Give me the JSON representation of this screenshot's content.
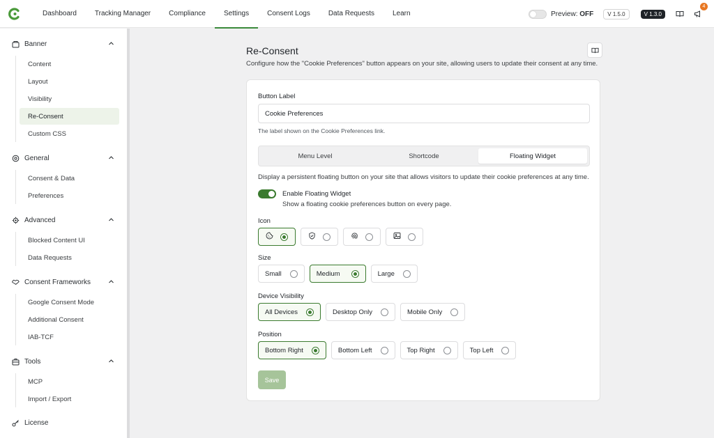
{
  "topnav": {
    "items": [
      "Dashboard",
      "Tracking Manager",
      "Compliance",
      "Settings",
      "Consent Logs",
      "Data Requests",
      "Learn"
    ],
    "active_index": 3,
    "preview_label": "Preview:",
    "preview_state": "OFF",
    "version_primary": "V 1.5.0",
    "version_secondary": "V 1.3.0",
    "notification_count": "4",
    "accent_color": "#3a8a3a"
  },
  "sidebar": {
    "sections": [
      {
        "label": "Banner",
        "icon": "banner-icon",
        "items": [
          "Content",
          "Layout",
          "Visibility",
          "Re-Consent",
          "Custom CSS"
        ]
      },
      {
        "label": "General",
        "icon": "gear-icon",
        "items": [
          "Consent & Data",
          "Preferences"
        ]
      },
      {
        "label": "Advanced",
        "icon": "cog-icon",
        "items": [
          "Blocked Content UI",
          "Data Requests"
        ]
      },
      {
        "label": "Consent Frameworks",
        "icon": "handshake-icon",
        "items": [
          "Google Consent Mode",
          "Additional Consent",
          "IAB-TCF"
        ]
      },
      {
        "label": "Tools",
        "icon": "toolbox-icon",
        "items": [
          "MCP",
          "Import / Export"
        ]
      }
    ],
    "active_item": "Re-Consent",
    "footer_item": "License"
  },
  "main": {
    "title": "Re-Consent",
    "description": "Configure how the \"Cookie Preferences\" button appears on your site, allowing users to update their consent at any time.",
    "button_label": {
      "label": "Button Label",
      "value": "Cookie Preferences",
      "hint": "The label shown on the Cookie Preferences link."
    },
    "tabs": [
      "Menu Level",
      "Shortcode",
      "Floating Widget"
    ],
    "active_tab": "Floating Widget",
    "widget_description": "Display a persistent floating button on your site that allows visitors to update their cookie preferences at any time.",
    "enable": {
      "label": "Enable Floating Widget",
      "description": "Show a floating cookie preferences button on every page.",
      "enabled": true
    },
    "icon_group": {
      "label": "Icon",
      "options": [
        "cookie-icon",
        "shield-check-icon",
        "fingerprint-icon",
        "image-icon"
      ],
      "selected_index": 0
    },
    "size_group": {
      "label": "Size",
      "options": [
        "Small",
        "Medium",
        "Large"
      ],
      "selected": "Medium"
    },
    "device_group": {
      "label": "Device Visibility",
      "options": [
        "All Devices",
        "Desktop Only",
        "Mobile Only"
      ],
      "selected": "All Devices"
    },
    "position_group": {
      "label": "Position",
      "options": [
        "Bottom Right",
        "Bottom Left",
        "Top Right",
        "Top Left"
      ],
      "selected": "Bottom Right"
    },
    "save_label": "Save"
  }
}
